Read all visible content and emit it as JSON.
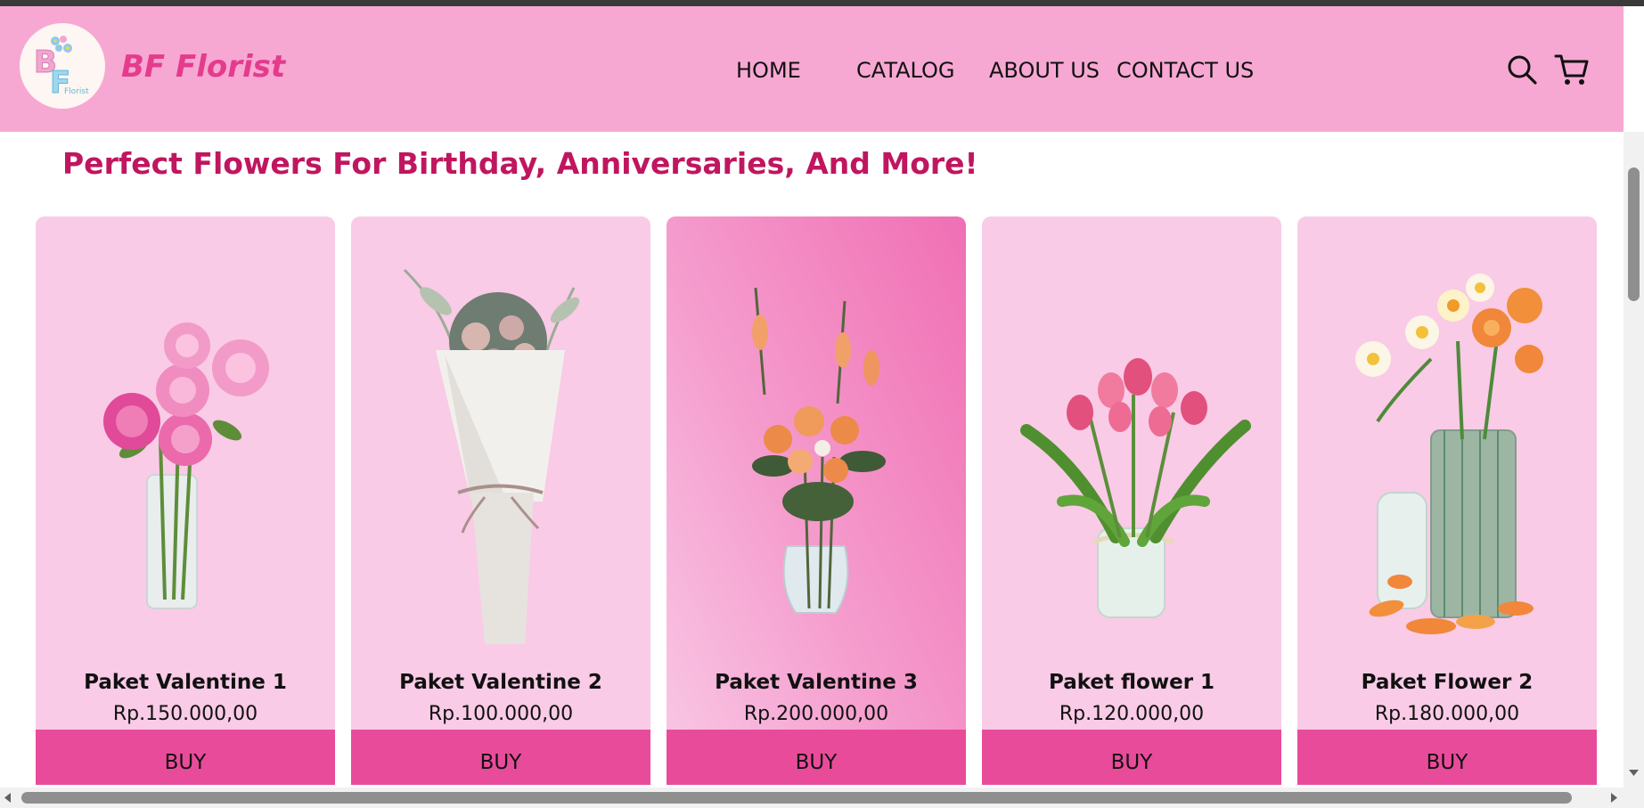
{
  "header": {
    "brand": "BF Florist",
    "logo_text": "Florist",
    "logo_letters": "BF",
    "nav": [
      "HOME",
      "CATALOG",
      "ABOUT US",
      "CONTACT US"
    ],
    "icons": [
      "search-icon",
      "cart-icon"
    ]
  },
  "main": {
    "heading": "Perfect Flowers For Birthday, Anniversaries, And More!",
    "products": [
      {
        "name": "Paket Valentine 1",
        "price": "Rp.150.000,00",
        "buy": "BUY"
      },
      {
        "name": "Paket Valentine 2",
        "price": "Rp.100.000,00",
        "buy": "BUY"
      },
      {
        "name": "Paket Valentine 3",
        "price": "Rp.200.000,00",
        "buy": "BUY"
      },
      {
        "name": "Paket flower 1",
        "price": "Rp.120.000,00",
        "buy": "BUY"
      },
      {
        "name": "Paket Flower 2",
        "price": "Rp.180.000,00",
        "buy": "BUY"
      }
    ]
  },
  "colors": {
    "header_bg": "#f7a8d2",
    "brand": "#e43b8d",
    "heading": "#c0165f",
    "card_bg": "#f9cbe6",
    "buy_bg": "#e94b9b"
  }
}
